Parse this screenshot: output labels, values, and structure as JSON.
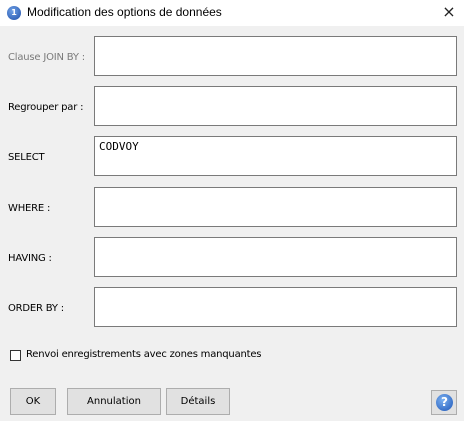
{
  "window": {
    "title": "Modification des options de données",
    "close_glyph": "×",
    "app_icon": "1"
  },
  "rows": [
    {
      "label": "Clause JOIN BY :",
      "value": "",
      "enabled": false
    },
    {
      "label": "Regrouper par :",
      "value": "",
      "enabled": true
    },
    {
      "label": "SELECT",
      "value": "CODVOY",
      "enabled": true
    },
    {
      "label": "WHERE :",
      "value": "",
      "enabled": true
    },
    {
      "label": "HAVING :",
      "value": "",
      "enabled": true
    },
    {
      "label": "ORDER BY :",
      "value": "",
      "enabled": true
    }
  ],
  "checkbox": {
    "label": "Renvoi enregistrements avec zones manquantes",
    "checked": false
  },
  "buttons": {
    "ok": "OK",
    "cancel": "Annulation",
    "details": "Détails",
    "help_glyph": "?"
  },
  "icons": {
    "app": "app-info-icon",
    "help": "help-icon",
    "close": "close-icon"
  },
  "colors": {
    "background": "#f0f0f0",
    "disabled_label": "#7a7a7a",
    "help_blue": "#1d56b8"
  }
}
